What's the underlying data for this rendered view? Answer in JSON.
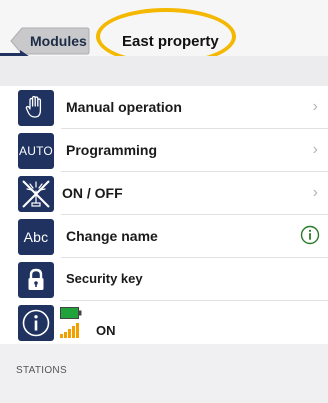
{
  "header": {
    "back_label": "Modules",
    "title": "East property"
  },
  "menu": [
    {
      "label": "Manual operation",
      "icon": "hand-icon",
      "has_chevron": true
    },
    {
      "label": "Programming",
      "icon": "auto-icon",
      "icon_text": "AUTO",
      "has_chevron": true
    },
    {
      "label": "ON / OFF",
      "icon": "sprinkler-off-icon",
      "has_chevron": true
    },
    {
      "label": "Change name",
      "icon": "abc-icon",
      "icon_text": "Abc",
      "has_info": true
    },
    {
      "label": "Security key",
      "icon": "padlock-icon"
    },
    {
      "label": "ON",
      "icon": "info-icon",
      "battery": "full",
      "signal": "strong"
    }
  ],
  "section": {
    "title": "STATIONS"
  },
  "colors": {
    "accent": "#1f3260",
    "highlight": "#f5b800",
    "battery": "#1fa33a",
    "signal": "#f2a000",
    "info_right": "#2b7a2b"
  }
}
